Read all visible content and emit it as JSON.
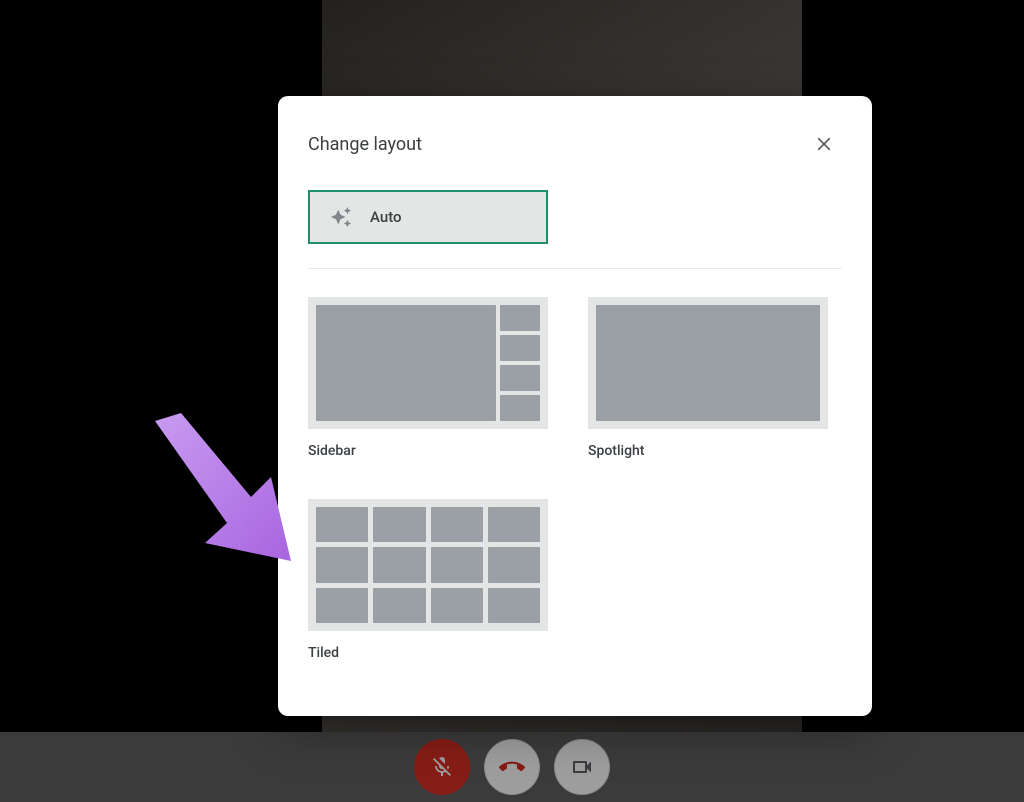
{
  "dialog": {
    "title": "Change layout",
    "auto_label": "Auto",
    "options": {
      "sidebar": "Sidebar",
      "spotlight": "Spotlight",
      "tiled": "Tiled"
    }
  },
  "colors": {
    "accent": "#1e8e6e",
    "arrow": "#b57ee8",
    "danger": "#d93025"
  }
}
